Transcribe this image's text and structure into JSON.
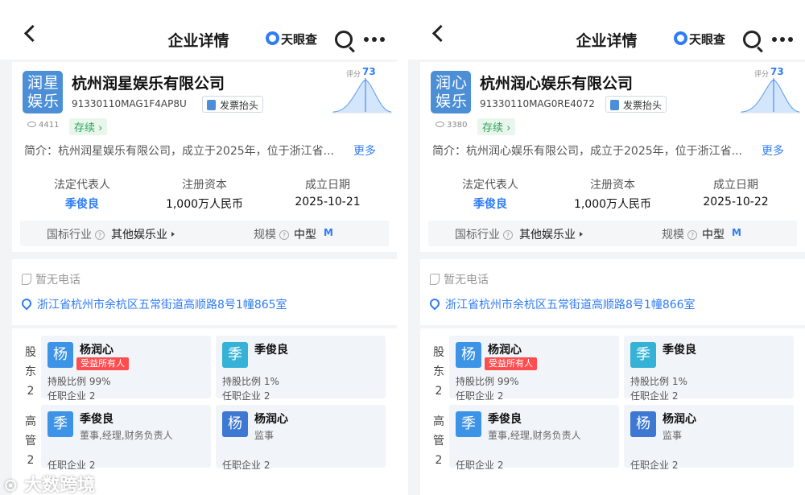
{
  "header": {
    "title": "企业详情",
    "brand": "天眼查",
    "icons": [
      "back-icon",
      "tianyancha-logo-icon",
      "search-icon",
      "more-icon"
    ]
  },
  "labels": {
    "invoice": "发票抬头",
    "score_prefix": "评分",
    "intro_prefix": "简介：",
    "more": "更多",
    "legal_rep": "法定代表人",
    "capital": "注册资本",
    "founded": "成立日期",
    "industry": "国标行业",
    "scale": "规模",
    "scale_badge": "M",
    "phone": "暂无电话",
    "shareholders_v": [
      "股",
      "东",
      "2"
    ],
    "executives_v": [
      "高",
      "管",
      "2"
    ],
    "holding_prefix": "持股比例",
    "positions_prefix": "任职企业"
  },
  "panels": [
    {
      "logo": "润星娱乐",
      "company_name": "杭州润星娱乐有限公司",
      "credit_code": "91330110MAG1F4AP8U",
      "views": "4411",
      "status": "存续",
      "score": "73",
      "intro": "杭州润星娱乐有限公司，成立于2025年，位于浙江省...",
      "legal_rep": "季俊良",
      "capital": "1,000万人民币",
      "founded": "2025-10-21",
      "industry": "其他娱乐业",
      "scale": "中型",
      "address": "浙江省杭州市余杭区五常街道高顺路8号1幢865室",
      "shareholders": [
        {
          "avatar": "杨",
          "name": "杨润心",
          "tag": "受益所有人",
          "holding": "99%",
          "positions": "2"
        },
        {
          "avatar": "季",
          "name": "季俊良",
          "holding": "1%",
          "positions": "2"
        }
      ],
      "executives": [
        {
          "avatar": "季",
          "name": "季俊良",
          "role": "董事,经理,财务负责人",
          "positions": "2"
        },
        {
          "avatar": "杨",
          "name": "杨润心",
          "role": "监事",
          "positions": "2"
        }
      ]
    },
    {
      "logo": "润心娱乐",
      "company_name": "杭州润心娱乐有限公司",
      "credit_code": "91330110MAG0RE4072",
      "views": "3380",
      "status": "存续",
      "score": "73",
      "intro": "杭州润心娱乐有限公司，成立于2025年，位于浙江省...",
      "legal_rep": "季俊良",
      "capital": "1,000万人民币",
      "founded": "2025-10-22",
      "industry": "其他娱乐业",
      "scale": "中型",
      "address": "浙江省杭州市余杭区五常街道高顺路8号1幢866室",
      "shareholders": [
        {
          "avatar": "杨",
          "name": "杨润心",
          "tag": "受益所有人",
          "holding": "99%",
          "positions": "2"
        },
        {
          "avatar": "季",
          "name": "季俊良",
          "holding": "1%",
          "positions": "2"
        }
      ],
      "executives": [
        {
          "avatar": "季",
          "name": "季俊良",
          "role": "董事,经理,财务负责人",
          "positions": "2"
        },
        {
          "avatar": "杨",
          "name": "杨润心",
          "role": "监事",
          "positions": "2"
        }
      ]
    }
  ],
  "watermark": "大数跨境",
  "colors": {
    "accent": "#2f7cf6",
    "status_green": "#2ea55a",
    "tag_red": "#ff4d4f",
    "logo_blue": "#4c8fd6"
  }
}
